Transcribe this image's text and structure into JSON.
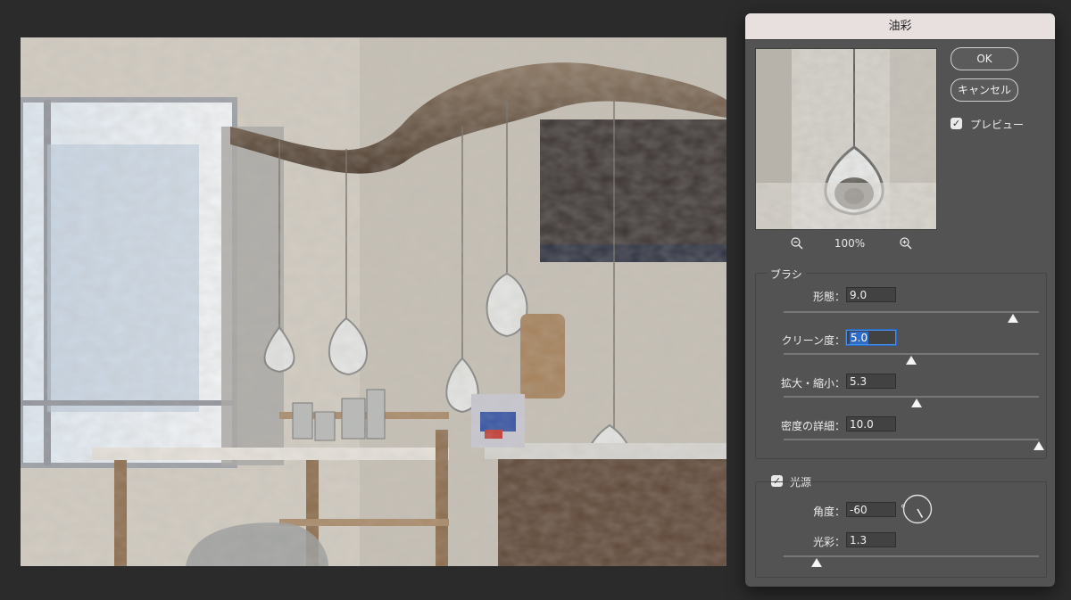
{
  "dialog": {
    "title": "油彩",
    "ok_label": "OK",
    "cancel_label": "キャンセル",
    "preview_label": "プレビュー",
    "preview_checked": true,
    "zoom": "100%"
  },
  "brush": {
    "group_title": "ブラシ",
    "sliders": [
      {
        "label": "形態：",
        "value": "9.0",
        "level": 0.9
      },
      {
        "label": "クリーン度：",
        "value": "5.0",
        "level": 0.5
      },
      {
        "label": "拡大・縮小：",
        "value": "5.3",
        "level": 0.52
      },
      {
        "label": "密度の詳細：",
        "value": "10.0",
        "level": 1.0
      }
    ]
  },
  "lighting": {
    "group_title": "光源",
    "enabled": true,
    "angle_label": "角度：",
    "angle_value": "-60",
    "angle_unit": "°",
    "shine_label": "光彩：",
    "shine_value": "1.3",
    "shine_level": 0.13
  },
  "icons": [
    "zoom-out-icon",
    "zoom-in-icon",
    "checkbox-check-icon",
    "angle-dial-icon"
  ],
  "colors": {
    "workspace": "#2b2b2b",
    "panel": "#535353",
    "titlebar": "#e8dfdf",
    "focus_accent": "#2d6cc9"
  }
}
